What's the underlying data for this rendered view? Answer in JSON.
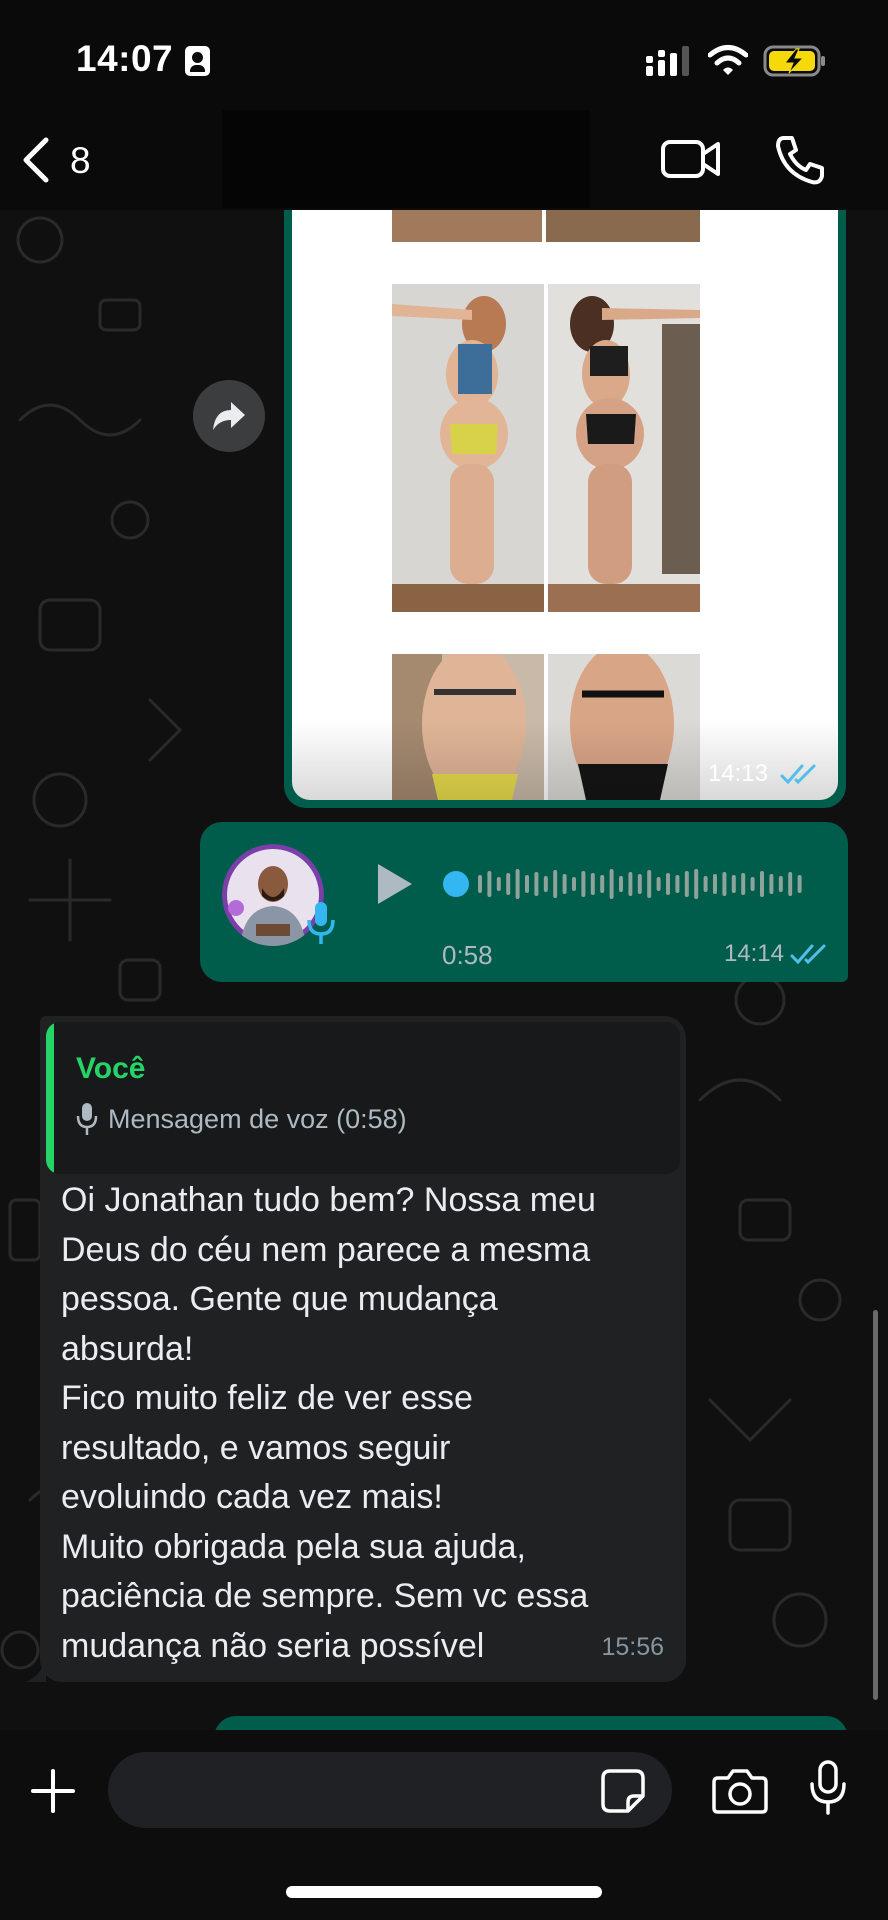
{
  "status_bar": {
    "time": "14:07",
    "battery_color": "#f5d90a"
  },
  "header": {
    "back_count": "8"
  },
  "messages": {
    "image": {
      "time": "14:13",
      "status": "read"
    },
    "voice": {
      "duration": "0:58",
      "time": "14:14",
      "status": "read"
    },
    "reply": {
      "quote_author": "Você",
      "quote_text": "Mensagem de voz (0:58)",
      "body": "Oi Jonathan tudo bem? Nossa meu\nDeus do céu nem parece a mesma\npessoa. Gente que mudança\nabsurda!\nFico muito feliz de ver esse\nresultado, e vamos seguir\nevoluindo cada vez mais!\nMuito obrigada pela sua ajuda,\npaciência de sempre. Sem vc essa\nmudança não seria possível",
      "time": "15:56"
    }
  },
  "composer": {
    "input_value": "",
    "placeholder": ""
  },
  "colors": {
    "outgoing_bubble": "#005c4b",
    "incoming_bubble": "#1f2123",
    "accent_green": "#25d366",
    "read_ticks": "#53bdeb"
  },
  "icons": [
    "id-card-icon",
    "signal-icon",
    "wifi-icon",
    "battery-icon",
    "back-chevron-icon",
    "video-call-icon",
    "phone-call-icon",
    "forward-icon",
    "play-icon",
    "mic-icon",
    "read-ticks-icon",
    "plus-icon",
    "sticker-icon",
    "camera-icon"
  ]
}
